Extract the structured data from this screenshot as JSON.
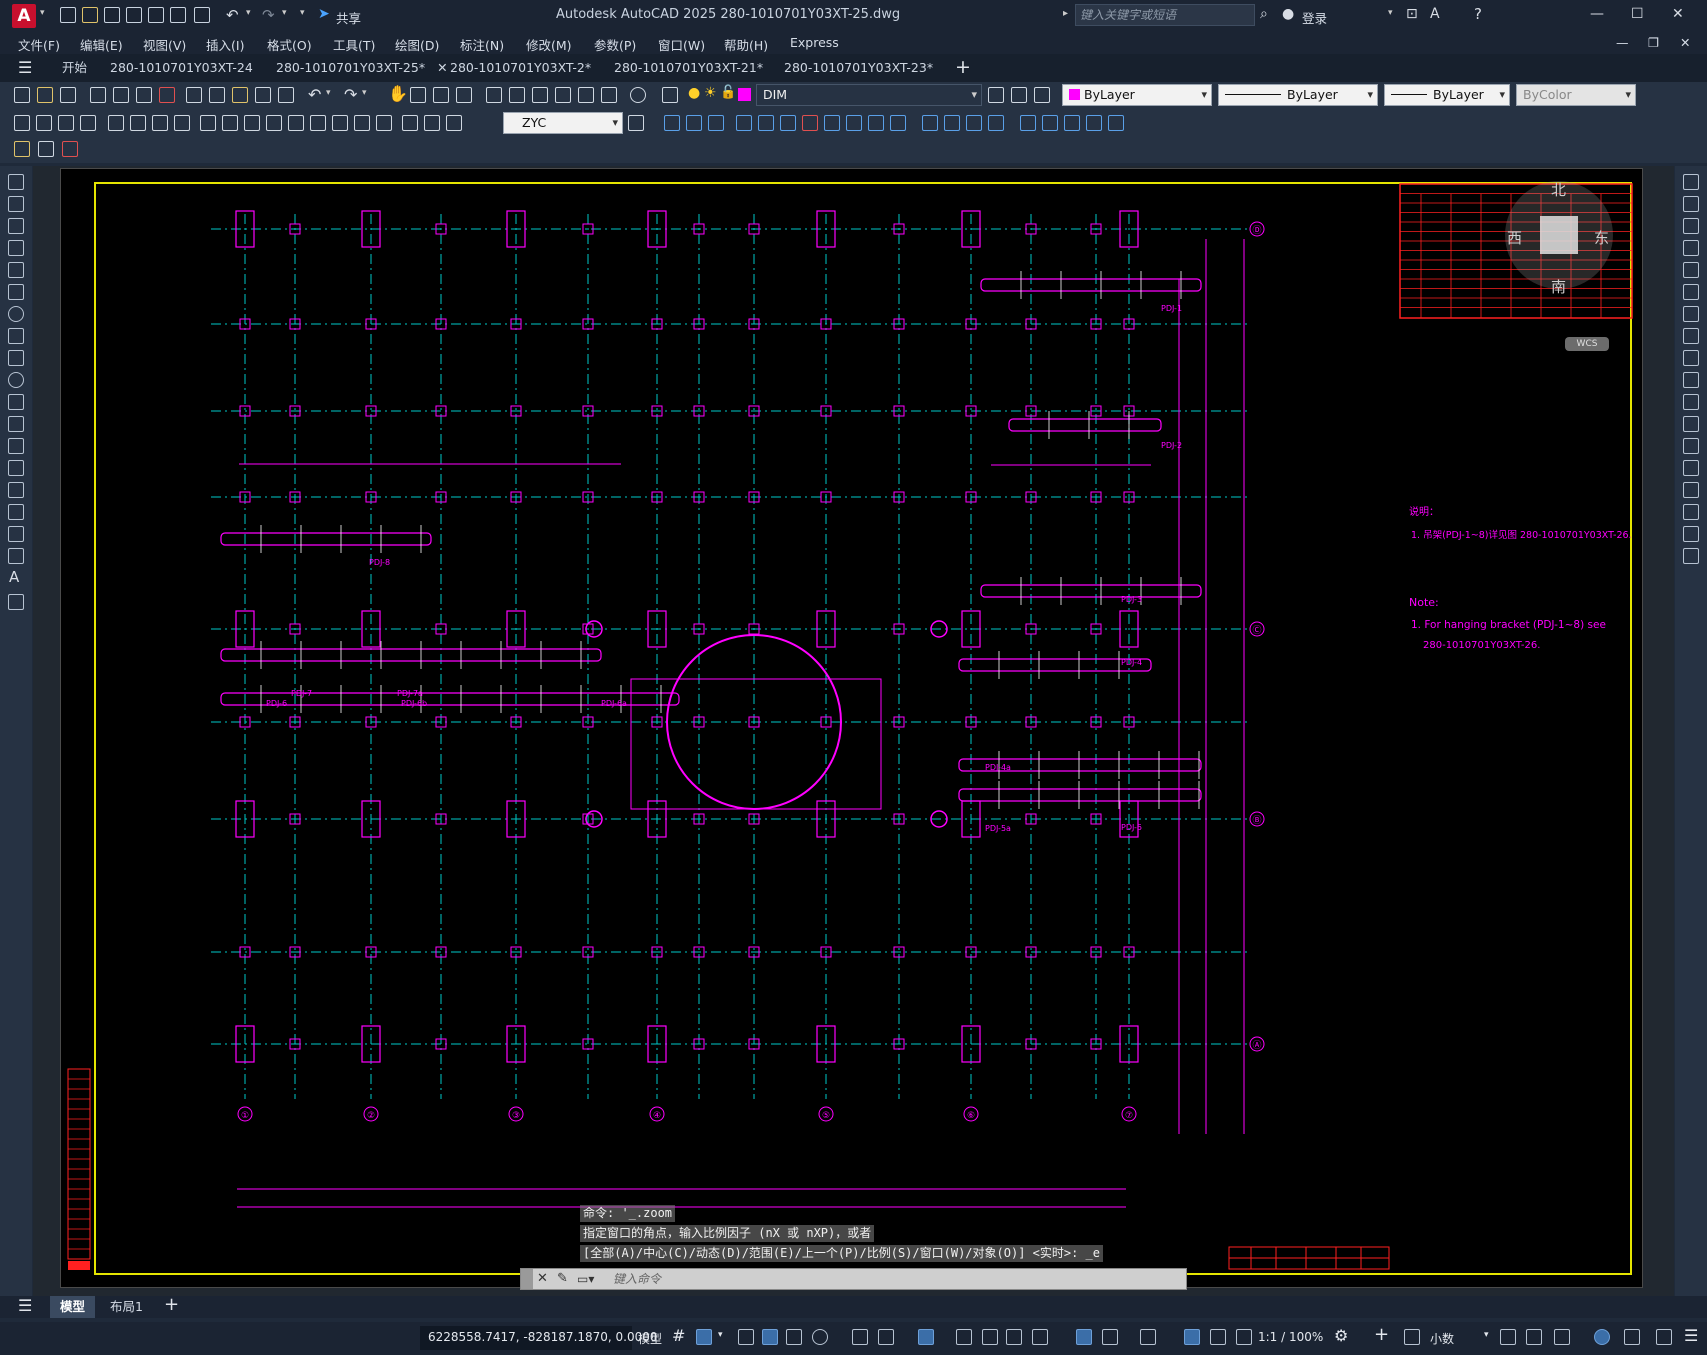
{
  "app": {
    "title": "Autodesk AutoCAD 2025    280-1010701Y03XT-25.dwg",
    "logo": "A",
    "share": "共享",
    "search_placeholder": "键入关键字或短语",
    "login": "登录"
  },
  "menus": [
    "文件(F)",
    "编辑(E)",
    "视图(V)",
    "插入(I)",
    "格式(O)",
    "工具(T)",
    "绘图(D)",
    "标注(N)",
    "修改(M)",
    "参数(P)",
    "窗口(W)",
    "帮助(H)",
    "Express"
  ],
  "tabs": [
    {
      "label": "开始",
      "active": false
    },
    {
      "label": "280-1010701Y03XT-24",
      "active": false
    },
    {
      "label": "280-1010701Y03XT-25*",
      "active": true
    },
    {
      "label": "280-1010701Y03XT-2*",
      "active": false
    },
    {
      "label": "280-1010701Y03XT-21*",
      "active": false
    },
    {
      "label": "280-1010701Y03XT-23*",
      "active": false
    }
  ],
  "toolbar": {
    "layer": "DIM",
    "color": "ByLayer",
    "linetype": "ByLayer",
    "lineweight": "ByLayer",
    "plotstyle": "ByColor",
    "dimstyle": "ZYC"
  },
  "colors": {
    "grid": "#00c8c8",
    "column": "#ff00ff",
    "border": "#e5e500",
    "title_block": "#ff2020",
    "text": "#ff00ff"
  },
  "viewcube": {
    "north": "北",
    "south": "南",
    "east": "东",
    "west": "西",
    "wcs": "WCS"
  },
  "drawing": {
    "axis_bottom": [
      "①",
      "②",
      "③",
      "④",
      "⑤",
      "⑥",
      "⑦"
    ],
    "axis_right": [
      "Ⓓ",
      "Ⓒ",
      "Ⓑ",
      "Ⓐ"
    ],
    "notes_cn_title": "说明：",
    "notes_cn": "1. 吊架(PDJ-1~8)详见图 280-1010701Y03XT-26.",
    "notes_en_title": "Note:",
    "notes_en_1": "1. For hanging bracket (PDJ-1~8) see",
    "notes_en_2": "280-1010701Y03XT-26.",
    "labels": {
      "pdj1": "PDJ-1",
      "pdj2": "PDJ-2",
      "pdj3": "PDJ-3",
      "pdj4": "PDJ-4",
      "pdj4a": "PDJ-4a",
      "pdj5": "PDJ-5",
      "pdj5a": "PDJ-5a",
      "pdj6": "PDJ-6",
      "pdj6a": "PDJ-6a",
      "pdj6b": "PDJ-6b",
      "pdj7": "PDJ-7",
      "pdj7a": "PDJ-7a",
      "pdj8": "PDJ-8"
    }
  },
  "command": {
    "line1": "命令: '_.zoom",
    "line2": "指定窗口的角点，输入比例因子 (nX 或 nXP)，或者",
    "line3": "[全部(A)/中心(C)/动态(D)/范围(E)/上一个(P)/比例(S)/窗口(W)/对象(O)] <实时>: _e",
    "input_placeholder": "键入命令"
  },
  "layouts": [
    {
      "label": "模型",
      "active": true
    },
    {
      "label": "布局1",
      "active": false
    }
  ],
  "status": {
    "coords": "6228558.7417, -828187.1870, 0.0000",
    "model": "模型",
    "scale": "1:1 / 100%",
    "units": "小数"
  }
}
